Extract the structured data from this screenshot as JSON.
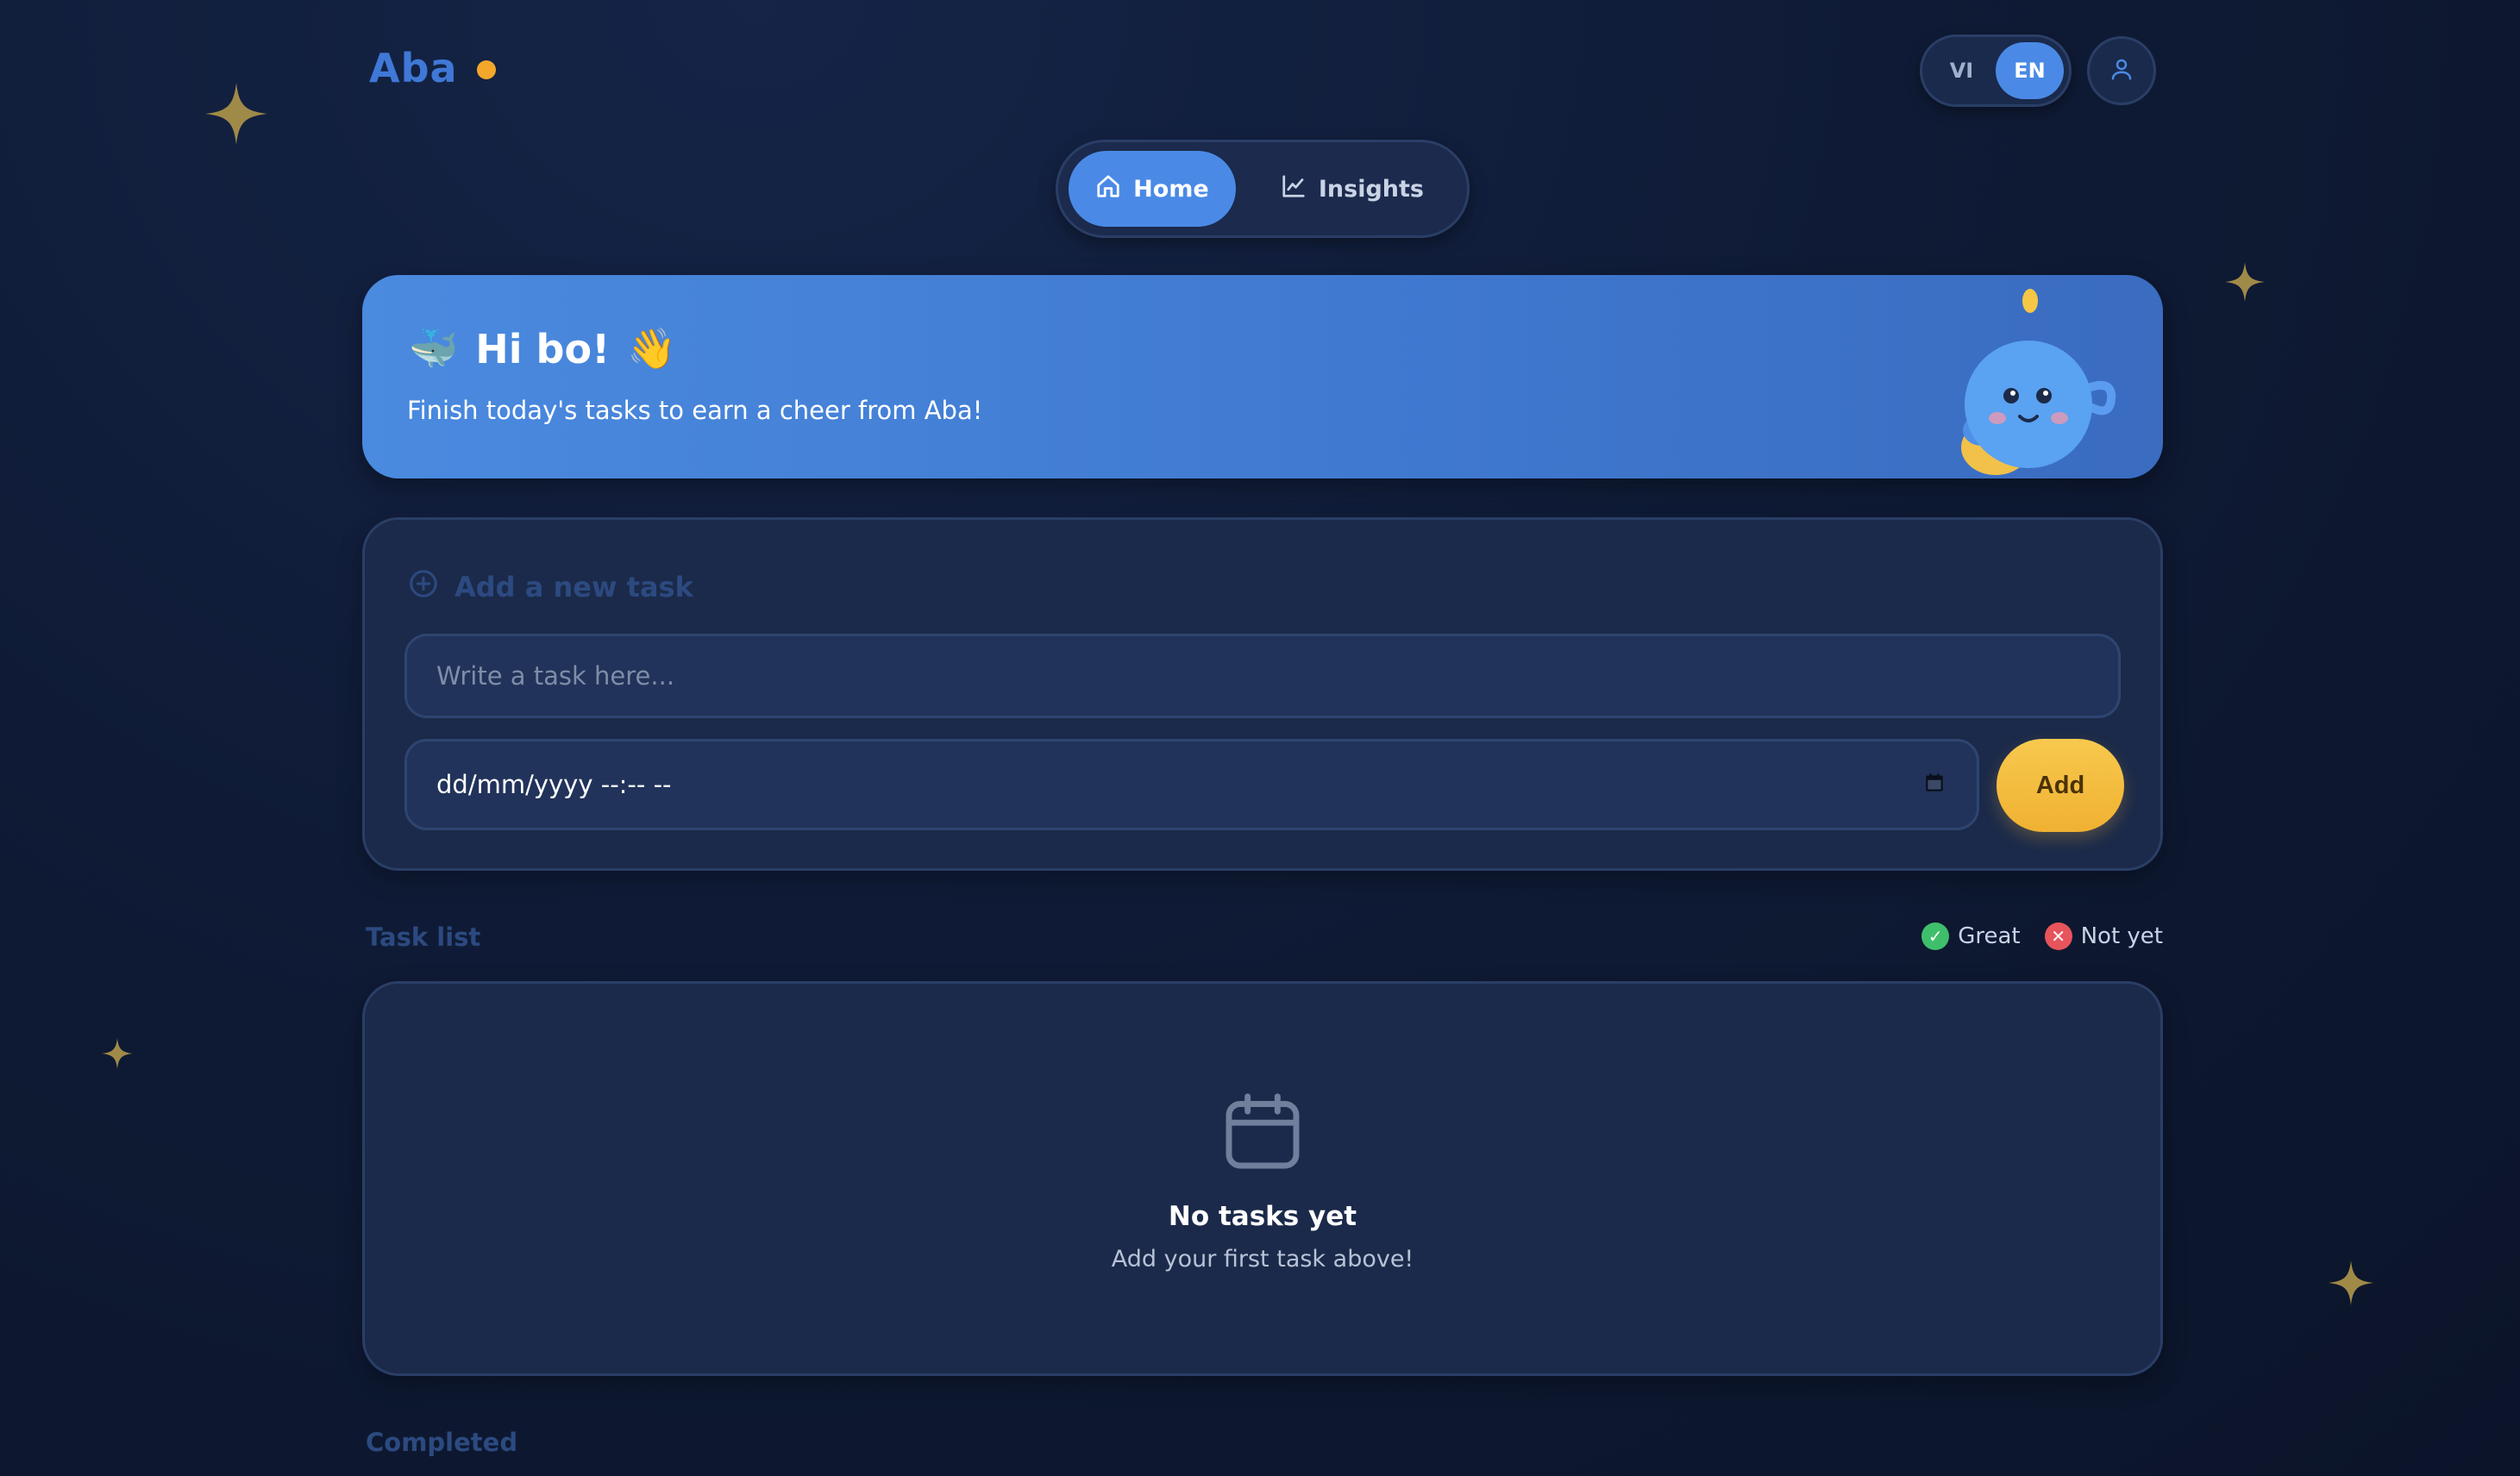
{
  "header": {
    "logo_text": "Aba",
    "lang_options": [
      "VI",
      "EN"
    ],
    "active_lang": "EN",
    "profile_icon": "user-icon"
  },
  "nav": {
    "tabs": [
      {
        "label": "Home",
        "icon": "home-icon",
        "active": true
      },
      {
        "label": "Insights",
        "icon": "chart-line-icon",
        "active": false
      }
    ]
  },
  "greeting": {
    "title": "Hi bo!",
    "wave_emoji": "👋",
    "whale_emoji": "🐳",
    "subtitle": "Finish today's tasks to earn a cheer from Aba!"
  },
  "add_task": {
    "heading": "Add a new task",
    "task_placeholder": "Write a task here...",
    "datetime_value": "dd/mm/yyyy --:-- --",
    "add_label": "Add"
  },
  "task_list": {
    "heading": "Task list",
    "legend": [
      {
        "label": "Great",
        "symbol": "✓",
        "color": "#3fbf6b"
      },
      {
        "label": "Not yet",
        "symbol": "✕",
        "color": "#e8545c"
      }
    ],
    "empty_title": "No tasks yet",
    "empty_subtitle": "Add your first task above!"
  },
  "completed": {
    "heading": "Completed"
  },
  "colors": {
    "accent": "#4a8ae6",
    "gold": "#f0b132",
    "background": "#0f1b36"
  }
}
